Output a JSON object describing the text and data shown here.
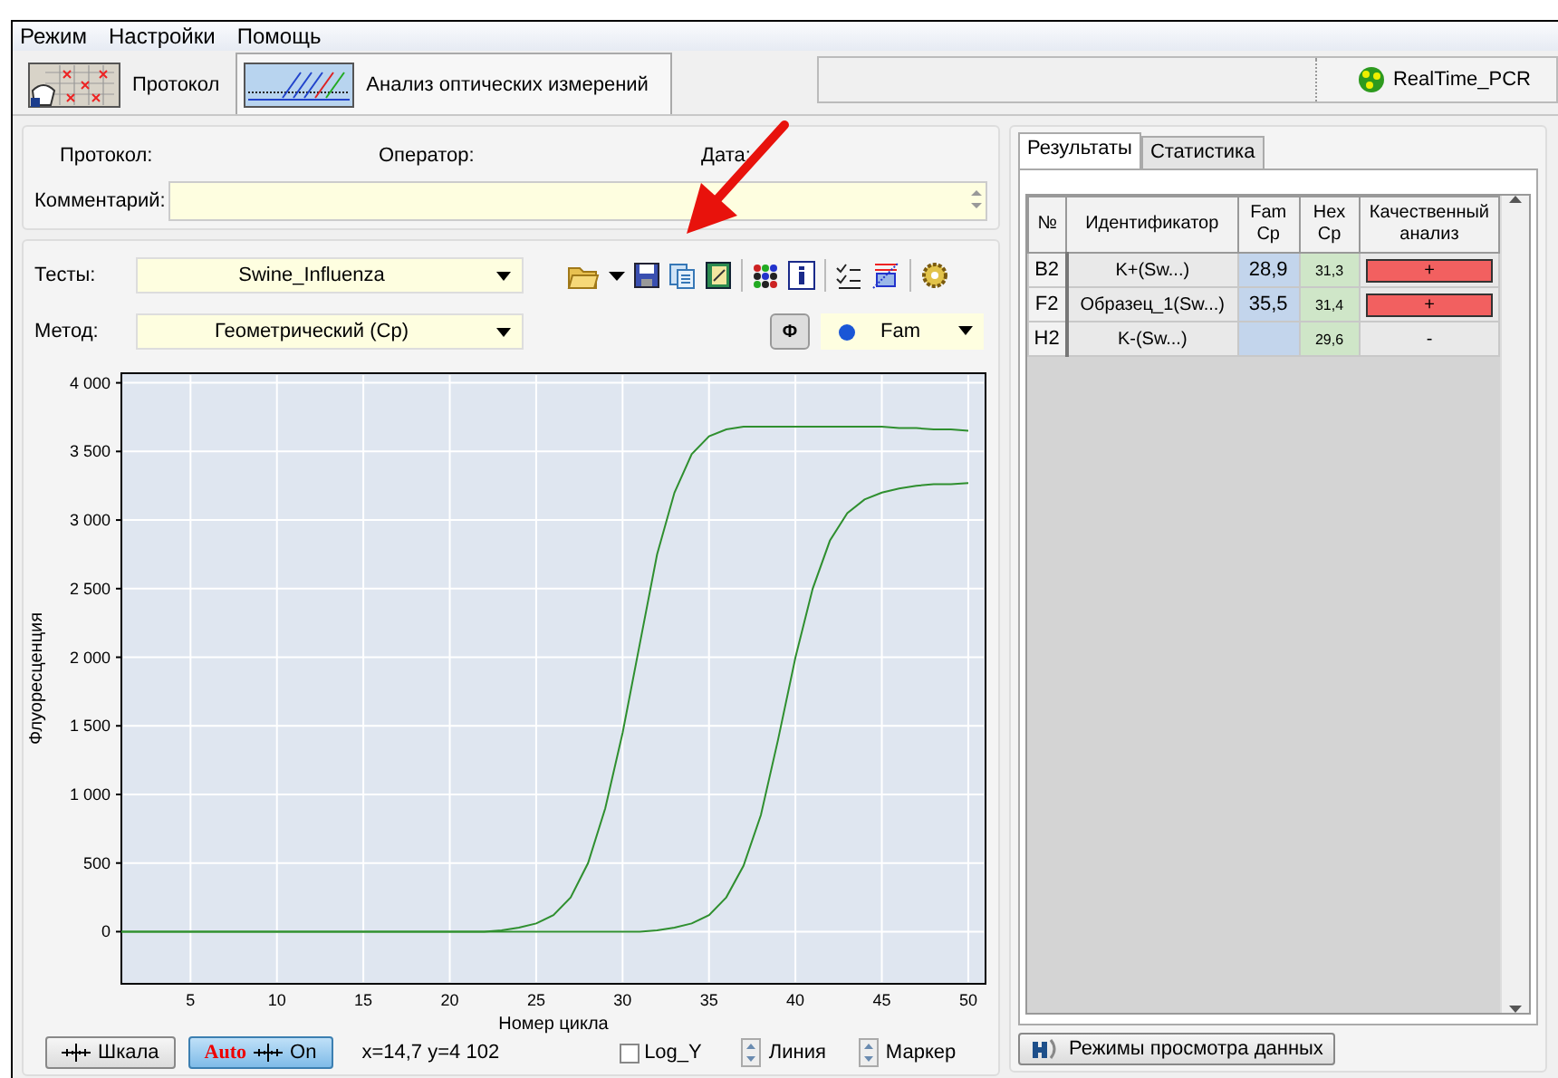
{
  "menu": [
    "Режим",
    "Настройки",
    "Помощь"
  ],
  "tabs": [
    {
      "label": "Протокол",
      "kind": "protocol",
      "selected": false
    },
    {
      "label": "Анализ оптических измерений",
      "kind": "analysis",
      "selected": true
    }
  ],
  "app_button": "RealTime_PCR",
  "protocol_info": {
    "protocol_label": "Протокол:",
    "operator_label": "Оператор:",
    "date_label": "Дата:",
    "comment_label": "Комментарий:"
  },
  "tests": {
    "label": "Тесты:",
    "value": "Swine_Influenza"
  },
  "method": {
    "label": "Метод:",
    "value": "Геометрический (Cp)"
  },
  "phi_button": "Φ",
  "channel": {
    "value": "Fam",
    "color": "#1a56d6"
  },
  "chart": {
    "chart_data": {
      "type": "line",
      "xlabel": "Номер цикла",
      "ylabel": "Флуоресценция",
      "x": [
        1,
        2,
        3,
        4,
        5,
        6,
        7,
        8,
        9,
        10,
        11,
        12,
        13,
        14,
        15,
        16,
        17,
        18,
        19,
        20,
        21,
        22,
        23,
        24,
        25,
        26,
        27,
        28,
        29,
        30,
        31,
        32,
        33,
        34,
        35,
        36,
        37,
        38,
        39,
        40,
        41,
        42,
        43,
        44,
        45,
        46,
        47,
        48,
        49,
        50
      ],
      "series": [
        {
          "color": "#2f8f2f",
          "values": [
            0,
            0,
            0,
            0,
            0,
            0,
            0,
            0,
            0,
            0,
            0,
            0,
            0,
            0,
            0,
            0,
            0,
            0,
            0,
            0,
            0,
            0,
            10,
            30,
            60,
            120,
            250,
            500,
            900,
            1450,
            2100,
            2750,
            3200,
            3480,
            3610,
            3660,
            3680,
            3680,
            3680,
            3680,
            3680,
            3680,
            3680,
            3680,
            3680,
            3670,
            3670,
            3660,
            3660,
            3650
          ]
        },
        {
          "color": "#2f8f2f",
          "values": [
            0,
            0,
            0,
            0,
            0,
            0,
            0,
            0,
            0,
            0,
            0,
            0,
            0,
            0,
            0,
            0,
            0,
            0,
            0,
            0,
            0,
            0,
            0,
            0,
            0,
            0,
            0,
            0,
            0,
            0,
            0,
            10,
            30,
            60,
            120,
            250,
            480,
            850,
            1400,
            2000,
            2500,
            2850,
            3050,
            3150,
            3200,
            3230,
            3250,
            3260,
            3260,
            3270
          ]
        }
      ],
      "grid": true,
      "xlim": [
        1,
        51
      ],
      "ylim": [
        -380,
        4070
      ],
      "xticks": [
        5,
        10,
        15,
        20,
        25,
        30,
        35,
        40,
        45,
        50
      ],
      "yticks": [
        {
          "value": 0,
          "label": "0"
        },
        {
          "value": 500,
          "label": "500"
        },
        {
          "value": 1000,
          "label": "1 000"
        },
        {
          "value": 1500,
          "label": "1 500"
        },
        {
          "value": 2000,
          "label": "2 000"
        },
        {
          "value": 2500,
          "label": "2 500"
        },
        {
          "value": 3000,
          "label": "3 000"
        },
        {
          "value": 3500,
          "label": "3 500"
        },
        {
          "value": 4000,
          "label": "4 000"
        }
      ]
    }
  },
  "controls": {
    "scale_button": "Шкала",
    "auto_button": {
      "prefix": "Auto",
      "label": "On",
      "on": true
    },
    "coordinates": "x=14,7 y=4 102",
    "log_y": {
      "label": "Log_Y",
      "checked": false
    },
    "line_spinner": "Линия",
    "marker_spinner": "Маркер"
  },
  "results": {
    "tabs": [
      {
        "label": "Результаты",
        "selected": true
      },
      {
        "label": "Статистика",
        "selected": false
      }
    ],
    "columns": [
      "№",
      "Идентификатор",
      "Fam Cp",
      "Hex Cp",
      "Качественный анализ"
    ],
    "rows": [
      {
        "well": "B2",
        "id": "K+(Sw...)",
        "fam": "28,9",
        "hex": "31,3",
        "result": "+",
        "positive": true
      },
      {
        "well": "F2",
        "id": "Образец_1(Sw...)",
        "fam": "35,5",
        "hex": "31,4",
        "result": "+",
        "positive": true
      },
      {
        "well": "H2",
        "id": "K-(Sw...)",
        "hex": "29,6",
        "result": "-",
        "positive": false
      }
    ],
    "view_modes_button": "Режимы просмотра данных"
  },
  "overlay": {
    "kind": "arrow"
  }
}
